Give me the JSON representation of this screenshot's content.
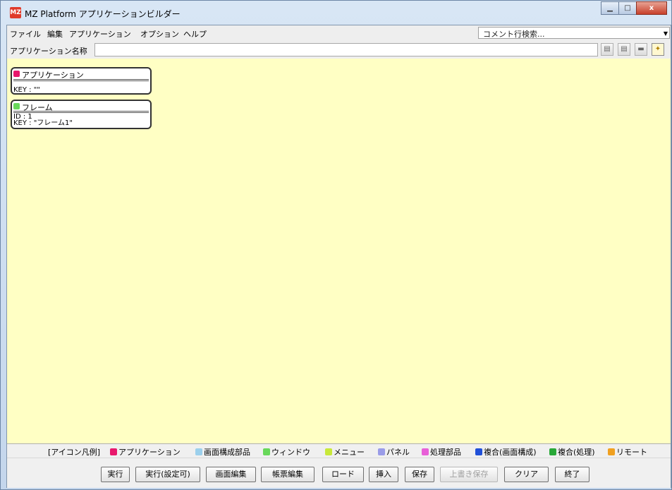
{
  "window": {
    "app_icon_text": "MZ",
    "title": "MZ Platform アプリケーションビルダー",
    "minimize_glyph": "▁",
    "maximize_glyph": "□",
    "close_glyph": "x"
  },
  "menu": {
    "items": [
      "ファイル",
      "編集",
      "アプリケーション",
      "オプション",
      "ヘルプ"
    ],
    "search_text": "コメント行検索..."
  },
  "namebar": {
    "label": "アプリケーション名称",
    "value": ""
  },
  "nodes": [
    {
      "title": "アプリケーション",
      "lines": [
        "KEY : \"\""
      ],
      "icon_color": "#e8186c"
    },
    {
      "title": "フレーム",
      "lines": [
        "ID : 1",
        "KEY : \"フレーム1\""
      ],
      "icon_color": "#68d85a"
    }
  ],
  "legend": {
    "caption": "[アイコン凡例]",
    "items": [
      {
        "label": "アプリケーション",
        "color": "#e8186c"
      },
      {
        "label": "画面構成部品",
        "color": "#9cd0ec"
      },
      {
        "label": "ウィンドウ",
        "color": "#68d85a"
      },
      {
        "label": "メニュー",
        "color": "#c8e83a"
      },
      {
        "label": "パネル",
        "color": "#9a9ce8"
      },
      {
        "label": "処理部品",
        "color": "#e860d8"
      },
      {
        "label": "複合(画面構成)",
        "color": "#2050d8"
      },
      {
        "label": "複合(処理)",
        "color": "#28a838"
      },
      {
        "label": "リモート",
        "color": "#f0a020"
      }
    ]
  },
  "buttons": {
    "run": "実行",
    "run_configurable": "実行(設定可)",
    "screen_edit": "画面編集",
    "form_edit": "帳票編集",
    "load": "ロード",
    "insert": "挿入",
    "save": "保存",
    "overwrite_save": "上書き保存",
    "clear": "クリア",
    "exit": "終了"
  },
  "colors": {
    "canvas_bg": "#ffffc4",
    "close_button": "#c7402b"
  }
}
